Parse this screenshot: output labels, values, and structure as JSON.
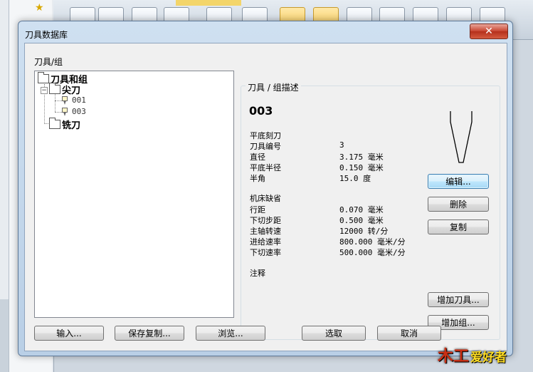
{
  "dialog": {
    "title": "刀具数据库",
    "close_glyph": "✕"
  },
  "tree_panel": {
    "label": "刀具/组",
    "root": "刀具和组",
    "group1": "尖刀",
    "tool1": "001",
    "tool2": "003",
    "group2": "铣刀",
    "expander_glyph": "−"
  },
  "description": {
    "caption": "刀具 / 组描述",
    "tool_name": "003",
    "tool_type": "平底刻刀",
    "props": [
      {
        "label": "刀具编号",
        "value": "3"
      },
      {
        "label": "直径",
        "value": "3.175 毫米"
      },
      {
        "label": "平底半径",
        "value": "0.150 毫米"
      },
      {
        "label": "半角",
        "value": "15.0 度"
      }
    ],
    "machine_default": "机床缺省",
    "machine_props": [
      {
        "label": "行距",
        "value": "0.070 毫米"
      },
      {
        "label": "下切步距",
        "value": "0.500 毫米"
      },
      {
        "label": "主轴转速",
        "value": "12000 转/分"
      },
      {
        "label": "进给速率",
        "value": "800.000 毫米/分"
      },
      {
        "label": "下切速率",
        "value": "500.000 毫米/分"
      }
    ],
    "notes_label": "注释"
  },
  "side_buttons": {
    "edit": "编辑...",
    "delete": "删除",
    "copy": "复制",
    "add_tool": "增加刀具...",
    "add_group": "增加组..."
  },
  "bottom_buttons": {
    "import": "输入...",
    "save_copy": "保存复制...",
    "browse": "浏览...",
    "select": "选取",
    "cancel": "取消"
  },
  "watermark": {
    "logo": "木工",
    "text": "爱好者"
  },
  "colors": {
    "dialog_frame": "#b9cfe6",
    "close_button": "#c7432f",
    "default_button_border": "#3c7fb1",
    "client_bg": "#f0f0f0"
  }
}
